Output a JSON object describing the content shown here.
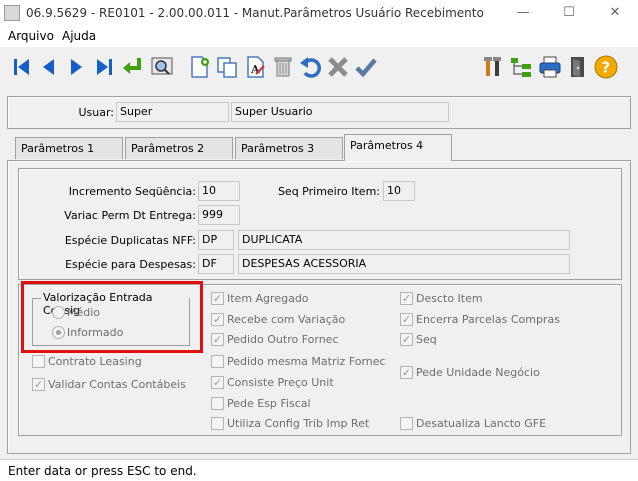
{
  "window": {
    "title": "06.9.5629 - RE0101 - 2.00.00.011 - Manut.Parâmetros Usuário Recebimento",
    "minimize": "—",
    "maximize": "☐",
    "close": "✕"
  },
  "menu": {
    "items": [
      "Arquivo",
      "Ajuda"
    ]
  },
  "toolbar": {
    "buttons": [
      "first-icon",
      "prev-icon",
      "next-icon",
      "last-icon",
      "goto-icon",
      "search-icon",
      "new-icon",
      "copy-icon",
      "edit-icon",
      "delete-icon",
      "undo-icon",
      "cancel-icon",
      "save-icon",
      "tools-icon",
      "tree-icon",
      "print-icon",
      "exit-icon",
      "help-icon"
    ]
  },
  "header": {
    "user_label": "Usuar:",
    "user_code": "Super",
    "user_name": "Super Usuario"
  },
  "tabs": [
    {
      "label": "Parâmetros 1"
    },
    {
      "label": "Parâmetros 2"
    },
    {
      "label": "Parâmetros 3"
    },
    {
      "label": "Parâmetros 4",
      "active": true
    }
  ],
  "params": {
    "incremento_label": "Incremento Seqüência:",
    "incremento_value": "10",
    "seq_primeiro_label": "Seq Primeiro Item:",
    "seq_primeiro_value": "10",
    "variac_label": "Variac Perm Dt Entrega:",
    "variac_value": "999",
    "especie_dup_label": "Espécie Duplicatas NFF:",
    "especie_dup_code": "DP",
    "especie_dup_desc": "DUPLICATA",
    "especie_desp_label": "Espécie para Despesas:",
    "especie_desp_code": "DF",
    "especie_desp_desc": "DESPESAS ACESSORIA"
  },
  "valorizacao": {
    "title": "Valorização Entrada Consig",
    "options": [
      "Médio",
      "Informado"
    ],
    "selected": "Informado"
  },
  "checkboxes_left": [
    {
      "label": "Contrato Leasing",
      "checked": false
    },
    {
      "label": "Validar Contas Contábeis",
      "checked": true
    }
  ],
  "checkboxes_mid": [
    {
      "label": "Item Agregado",
      "checked": true
    },
    {
      "label": "Recebe com Variação",
      "checked": true
    },
    {
      "label": "Pedido Outro Fornec",
      "checked": true
    },
    {
      "label": "Pedido mesma Matriz Fornec",
      "checked": false
    },
    {
      "label": "Consiste Preço Unit",
      "checked": true
    },
    {
      "label": "Pede Esp Fiscal",
      "checked": false
    },
    {
      "label": "Utiliza Config Trib Imp Ret",
      "checked": false
    }
  ],
  "checkboxes_right": [
    {
      "label": "Descto Item",
      "checked": true
    },
    {
      "label": "Encerra Parcelas Compras",
      "checked": true
    },
    {
      "label": "Seq",
      "checked": true
    },
    {
      "label": "Pede Unidade Negócio",
      "checked": true
    },
    {
      "label": "Desatualiza Lancto GFE",
      "checked": false
    }
  ],
  "status": {
    "text": "Enter data or press ESC to end."
  }
}
